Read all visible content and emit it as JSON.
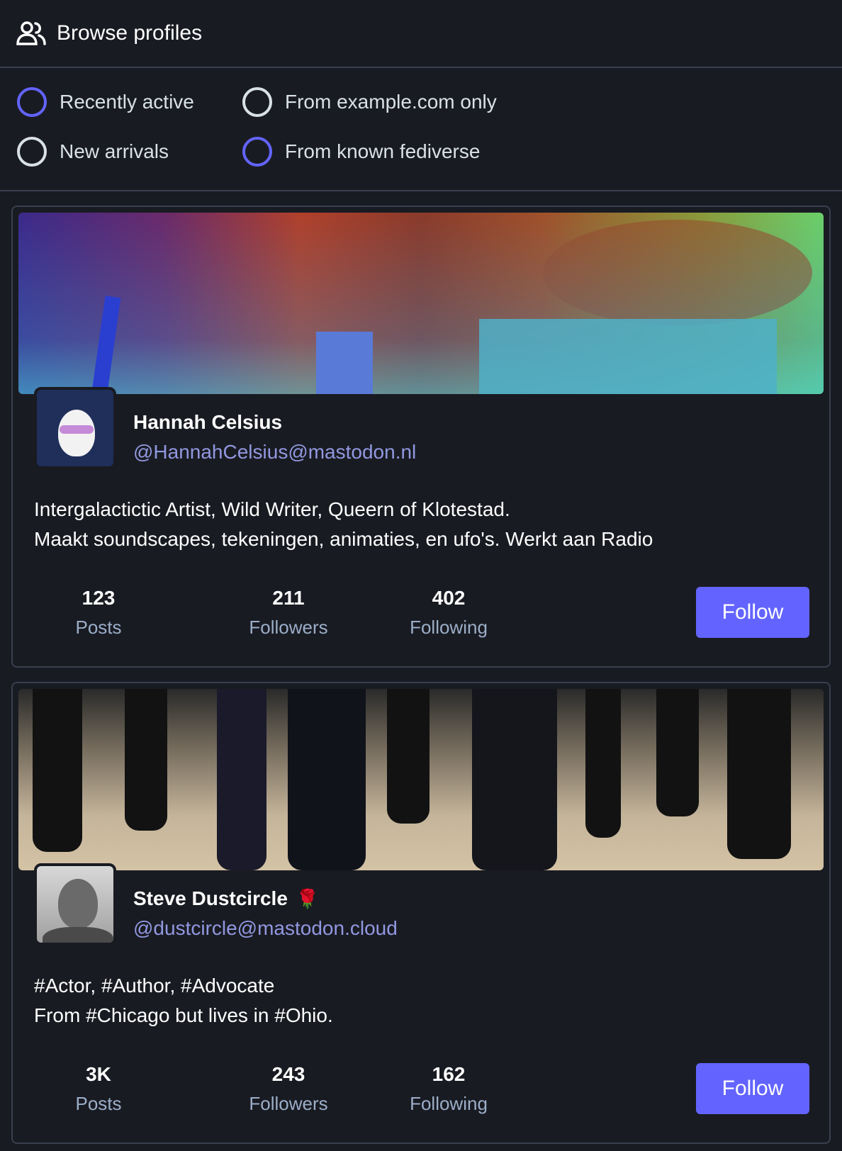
{
  "header": {
    "title": "Browse profiles",
    "icon": "people-icon"
  },
  "filters": {
    "options": [
      {
        "label": "Recently active",
        "checked": true
      },
      {
        "label": "From example.com only",
        "checked": false
      },
      {
        "label": "New arrivals",
        "checked": false
      },
      {
        "label": "From known fediverse",
        "checked": true
      }
    ]
  },
  "accent_color": "#6364ff",
  "profiles": [
    {
      "display_name": "Hannah Celsius",
      "handle": "@HannahCelsius@mastodon.nl",
      "bio_lines": [
        "Intergalactictic Artist, Wild Writer, Queern of Klotestad.",
        "Maakt soundscapes, tekeningen, animaties, en ufo's. Werkt aan Radio"
      ],
      "stats": [
        {
          "value": "123",
          "label": "Posts"
        },
        {
          "value": "211",
          "label": "Followers"
        },
        {
          "value": "402",
          "label": "Following"
        }
      ],
      "follow_label": "Follow"
    },
    {
      "display_name": "Steve Dustcircle",
      "emoji": "🌹",
      "handle": "@dustcircle@mastodon.cloud",
      "bio_lines": [
        "#Actor, #Author, #Advocate",
        "From #Chicago but lives in #Ohio."
      ],
      "stats": [
        {
          "value": "3K",
          "label": "Posts"
        },
        {
          "value": "243",
          "label": "Followers"
        },
        {
          "value": "162",
          "label": "Following"
        }
      ],
      "follow_label": "Follow"
    }
  ]
}
